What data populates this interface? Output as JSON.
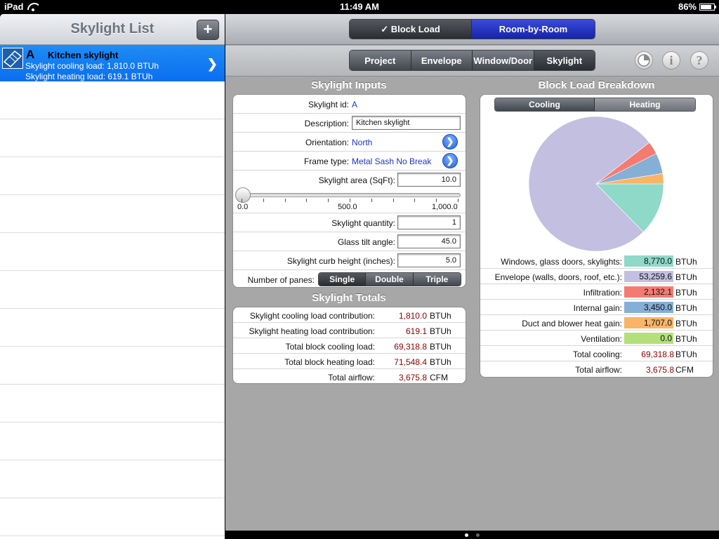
{
  "status": {
    "device": "iPad",
    "time": "11:49 AM",
    "battery": "86%",
    "battery_level": 0.86
  },
  "left": {
    "title": "Skylight List",
    "add_label": "+",
    "selected": {
      "id": "A",
      "name": "Kitchen skylight",
      "line1": "Skylight cooling load: 1,810.0 BTUh",
      "line2": "Skylight heating load: 619.1 BTUh"
    }
  },
  "toolbar": {
    "block_load": "✓ Block Load",
    "room_by_room": "Room-by-Room",
    "tabs": [
      "Project",
      "Envelope",
      "Window/Door",
      "Skylight"
    ],
    "pie_icon": "pie-chart-icon",
    "info_label": "i",
    "help_label": "?"
  },
  "inputs": {
    "title": "Skylight Inputs",
    "id_label": "Skylight id:",
    "id_value": "A",
    "desc_label": "Description:",
    "desc_value": "Kitchen skylight",
    "orient_label": "Orientation:",
    "orient_value": "North",
    "frame_label": "Frame type:",
    "frame_value": "Metal Sash No Break",
    "area_label": "Skylight area (SqFt):",
    "area_value": "10.0",
    "slider_min": "0.0",
    "slider_mid": "500.0",
    "slider_max": "1,000.0",
    "slider_value": 0.01,
    "qty_label": "Skylight quantity:",
    "qty_value": "1",
    "tilt_label": "Glass tilt angle:",
    "tilt_value": "45.0",
    "curb_label": "Skylight curb height (inches):",
    "curb_value": "5.0",
    "panes_label": "Number of panes:",
    "panes": [
      "Single",
      "Double",
      "Triple"
    ],
    "panes_selected": "Single"
  },
  "totals": {
    "title": "Skylight Totals",
    "rows": [
      {
        "label": "Skylight cooling load contribution:",
        "value": "1,810.0",
        "unit": "BTUh"
      },
      {
        "label": "Skylight heating load contribution:",
        "value": "619.1",
        "unit": "BTUh"
      },
      {
        "label": "Total block cooling load:",
        "value": "69,318.8",
        "unit": "BTUh"
      },
      {
        "label": "Total block heating load:",
        "value": "71,548.4",
        "unit": "BTUh"
      },
      {
        "label": "Total airflow:",
        "value": "3,675.8",
        "unit": "CFM"
      }
    ]
  },
  "breakdown": {
    "title": "Block Load Breakdown",
    "tabs": [
      "Cooling",
      "Heating"
    ],
    "rows": [
      {
        "label": "Windows, glass doors, skylights:",
        "value": "8,770.0",
        "unit": "BTUh",
        "color": "#8fd9c9"
      },
      {
        "label": "Envelope (walls, doors, roof, etc.):",
        "value": "53,259.6",
        "unit": "BTUh",
        "color": "#c3bfe1"
      },
      {
        "label": "Infiltration:",
        "value": "2,132.1",
        "unit": "BTUh",
        "color": "#f47b72"
      },
      {
        "label": "Internal gain:",
        "value": "3,450.0",
        "unit": "BTUh",
        "color": "#86afd6"
      },
      {
        "label": "Duct and blower heat gain:",
        "value": "1,707.0",
        "unit": "BTUh",
        "color": "#f9b467"
      },
      {
        "label": "Ventilation:",
        "value": "0.0",
        "unit": "BTUh",
        "color": "#b4e07a"
      }
    ],
    "total_cooling_label": "Total cooling:",
    "total_cooling_value": "69,318.8",
    "total_cooling_unit": "BTUh",
    "total_airflow_label": "Total airflow:",
    "total_airflow_value": "3,675.8",
    "total_airflow_unit": "CFM"
  },
  "chart_data": {
    "type": "pie",
    "labels": [
      "Windows, glass doors, skylights",
      "Envelope (walls, doors, roof, etc.)",
      "Infiltration",
      "Internal gain",
      "Duct and blower heat gain",
      "Ventilation"
    ],
    "values": [
      8770.0,
      53259.6,
      2132.1,
      3450.0,
      1707.0,
      0.0
    ],
    "colors": [
      "#8fd9c9",
      "#c3bfe1",
      "#f47b72",
      "#86afd6",
      "#f9b467",
      "#b4e07a"
    ]
  }
}
